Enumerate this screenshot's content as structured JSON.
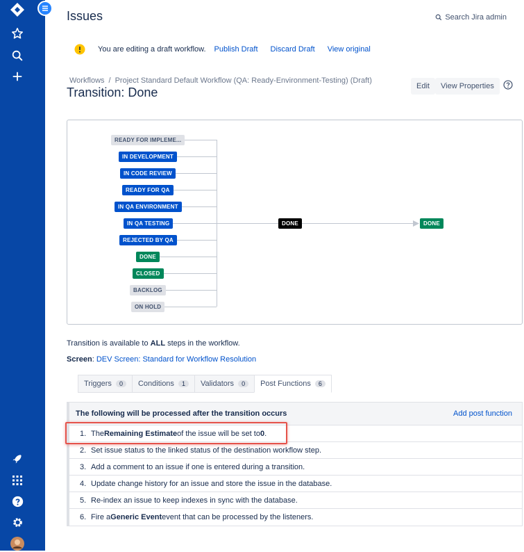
{
  "page": {
    "title": "Issues",
    "search_admin": "Search Jira admin"
  },
  "draft_bar": {
    "message": "You are editing a draft workflow.",
    "publish": "Publish Draft",
    "discard": "Discard Draft",
    "view_original": "View original"
  },
  "breadcrumb": {
    "root": "Workflows",
    "sep": "/",
    "current": "Project Standard Default Workflow (QA: Ready-Environment-Testing) (Draft)"
  },
  "transition_title": "Transition: Done",
  "header_buttons": {
    "edit": "Edit",
    "view_properties": "View Properties"
  },
  "diagram": {
    "from_statuses": [
      {
        "label": "READY FOR IMPLEME...",
        "color": "grey"
      },
      {
        "label": "IN DEVELOPMENT",
        "color": "blue"
      },
      {
        "label": "IN CODE REVIEW",
        "color": "blue"
      },
      {
        "label": "READY FOR QA",
        "color": "blue"
      },
      {
        "label": "IN QA ENVIRONMENT",
        "color": "blue"
      },
      {
        "label": "IN QA TESTING",
        "color": "blue"
      },
      {
        "label": "REJECTED BY QA",
        "color": "blue"
      },
      {
        "label": "DONE",
        "color": "green"
      },
      {
        "label": "CLOSED",
        "color": "green"
      },
      {
        "label": "BACKLOG",
        "color": "grey"
      },
      {
        "label": "ON HOLD",
        "color": "grey"
      }
    ],
    "transition_label": "Done",
    "target_status": "DONE"
  },
  "info": {
    "available_prefix": "Transition is available to",
    "available_bold": "ALL",
    "available_suffix": "steps in the workflow.",
    "screen_label": "Screen",
    "screen_link": "DEV Screen: Standard for Workflow Resolution"
  },
  "tabs": [
    {
      "label": "Triggers",
      "count": "0"
    },
    {
      "label": "Conditions",
      "count": "1"
    },
    {
      "label": "Validators",
      "count": "0"
    },
    {
      "label": "Post Functions",
      "count": "6"
    }
  ],
  "post_functions": {
    "heading": "The following will be processed after the transition occurs",
    "add_link": "Add post function",
    "items": [
      {
        "num": "1.",
        "pre": "The",
        "bold": "Remaining Estimate",
        "post": "of the issue will be set to",
        "bold2": "0",
        "end": "."
      },
      {
        "num": "2.",
        "pre": "Set issue status to the linked status of the destination workflow step.",
        "bold": "",
        "post": "",
        "bold2": "",
        "end": ""
      },
      {
        "num": "3.",
        "pre": "Add a comment to an issue if one is entered during a transition.",
        "bold": "",
        "post": "",
        "bold2": "",
        "end": ""
      },
      {
        "num": "4.",
        "pre": "Update change history for an issue and store the issue in the database.",
        "bold": "",
        "post": "",
        "bold2": "",
        "end": ""
      },
      {
        "num": "5.",
        "pre": "Re-index an issue to keep indexes in sync with the database.",
        "bold": "",
        "post": "",
        "bold2": "",
        "end": ""
      },
      {
        "num": "6.",
        "pre": "Fire a",
        "bold": "Generic Event",
        "post": "event that can be processed by the listeners.",
        "bold2": "",
        "end": ""
      }
    ]
  },
  "colors": {
    "nav_bg": "#0747a6",
    "link": "#0052cc",
    "lozenge_blue": "#0052cc",
    "lozenge_green": "#00875a",
    "lozenge_grey": "#dfe1e6",
    "highlight": "#e5534b"
  }
}
